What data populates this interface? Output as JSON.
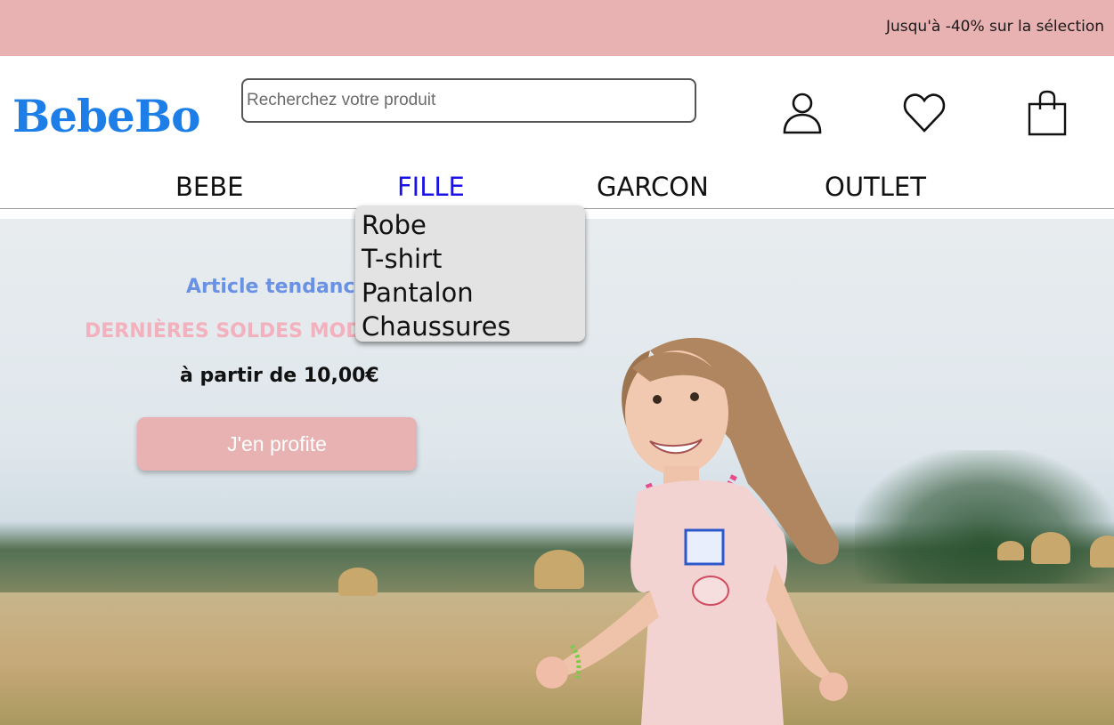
{
  "promo": {
    "text": "Jusqu'à -40% sur la sélection"
  },
  "header": {
    "logo": "BebeBo",
    "search": {
      "placeholder": "Recherchez votre produit",
      "value": ""
    },
    "icons": [
      "user-icon",
      "heart-icon",
      "shopping-bag-icon"
    ]
  },
  "nav": {
    "items": [
      {
        "label": "BEBE"
      },
      {
        "label": "FILLE",
        "active": true
      },
      {
        "label": "GARCON"
      },
      {
        "label": "OUTLET"
      }
    ]
  },
  "dropdown": {
    "items": [
      {
        "label": "Robe"
      },
      {
        "label": "T-shirt"
      },
      {
        "label": "Pantalon"
      },
      {
        "label": "Chaussures"
      }
    ]
  },
  "hero": {
    "tag": "Article tendance",
    "sale": "DERNIÈRES SOLDES MODE",
    "price": "à partir de 10,00€",
    "cta": "J'en profite"
  },
  "colors": {
    "promo_bg": "#e8b1b2",
    "logo": "#1c7ee6",
    "nav_active": "#1a12e6",
    "tag": "#6a92e4",
    "sale": "#f3b0bd",
    "dropdown_bg": "#e3e3e3"
  }
}
